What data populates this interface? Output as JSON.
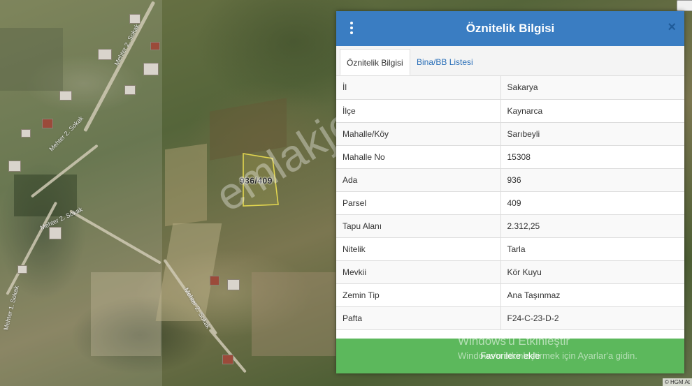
{
  "map": {
    "parcel_label": "936/409",
    "watermark": "emlakjet.com",
    "street_labels": [
      "Mehter 2. Sokak",
      "Mehter 2. Sokak",
      "Mehter 2. Sokak",
      "Mehter 1. Sokak",
      "Mehter 2. Sokak"
    ],
    "attribution": "© HGM At"
  },
  "panel": {
    "title": "Öznitelik Bilgisi",
    "menu_icon": "kebab-vertical-icon",
    "close_icon": "close-icon",
    "close_glyph": "×",
    "tabs": [
      {
        "label": "Öznitelik Bilgisi",
        "active": true
      },
      {
        "label": "Bina/BB Listesi",
        "active": false
      }
    ],
    "rows": [
      {
        "key": "İl",
        "value": "Sakarya"
      },
      {
        "key": "İlçe",
        "value": "Kaynarca"
      },
      {
        "key": "Mahalle/Köy",
        "value": "Sarıbeyli"
      },
      {
        "key": "Mahalle No",
        "value": "15308"
      },
      {
        "key": "Ada",
        "value": "936"
      },
      {
        "key": "Parsel",
        "value": "409"
      },
      {
        "key": "Tapu Alanı",
        "value": "2.312,25"
      },
      {
        "key": "Nitelik",
        "value": "Tarla"
      },
      {
        "key": "Mevkii",
        "value": "Kör Kuyu"
      },
      {
        "key": "Zemin Tip",
        "value": "Ana Taşınmaz"
      },
      {
        "key": "Pafta",
        "value": "F24-C-23-D-2"
      }
    ],
    "favorite_button": "Favorilere ekle",
    "header_color": "#3a7dc2",
    "button_color": "#5cb85c"
  },
  "os_overlay": {
    "line1": "Windows'u Etkinleştir",
    "line2": "Windows'u etkinleştirmek için Ayarlar'a gidin."
  }
}
